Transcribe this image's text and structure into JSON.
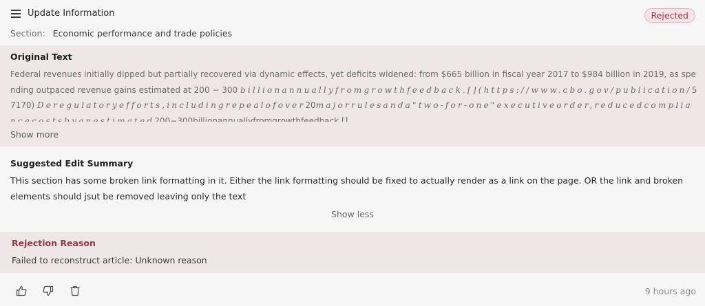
{
  "header": {
    "title": "Update Information",
    "status_badge": "Rejected",
    "section_label": "Section:",
    "section_value": "Economic performance and trade policies",
    "menu_icon": "hamburger-menu-icon"
  },
  "original_text": {
    "heading": "Original Text",
    "line1": "Federal revenues initially dipped but partially recovered via dynamic effects, yet deficits widened: from $665 billion in fiscal year 2017 to $984 billion in 2019, as spending",
    "line2_plain": "outpaced revenue gains estimated at 200 − 300 ",
    "line2_italic": "billionannuallyfromgrowthfeedback.[](https://www.cbo.gov/publication/",
    "line2_tail": "57170) ",
    "line2_italic_end": "Der",
    "line3_italic": "egulatoryefforts,includingrepealofover",
    "line3_num": "20",
    "line3_italic_b": "majorrulesanda\"two-for-one\"executiveorder,reducedcompliancecostsby",
    "line4_italic": "anestimated",
    "line4_plain": "200−300billionannuallyfromgrowthfeedback.[]…",
    "show_more": "Show more"
  },
  "summary": {
    "heading": "Suggested Edit Summary",
    "text": "THis section has some broken link formatting in it. Either the link formatting should be fixed to actually render as a link on the page. OR the link and broken elements should jsut be removed leaving only the text",
    "show_less": "Show less"
  },
  "rejection": {
    "heading": "Rejection Reason",
    "text": "Failed to reconstruct article: Unknown reason"
  },
  "footer": {
    "actions": [
      "thumbs-up-icon",
      "thumbs-down-icon",
      "trash-icon"
    ],
    "timestamp": "9 hours ago"
  },
  "colors": {
    "badge_text": "#9b3a48",
    "badge_bg": "#f7e4e6",
    "highlight_bg": "#efe6e7",
    "rejection_heading": "#8e3b45"
  }
}
